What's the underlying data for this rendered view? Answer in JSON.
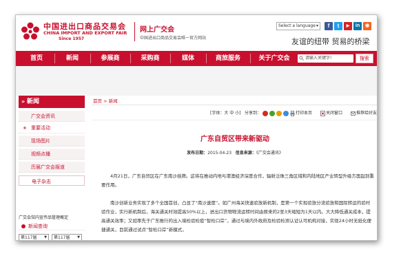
{
  "header": {
    "logo_cn": "中国进出口商品交易会",
    "logo_en": "CHINA IMPORT AND EXPORT FAIR",
    "logo_since": "Since 1957",
    "site_title": "网上广交会",
    "site_subtitle": "中国进出口商品交易会唯一官方网站",
    "language_select": "Select a language",
    "social_icons": [
      "facebook-icon",
      "twitter-icon",
      "youtube-icon",
      "linkedin-icon",
      "rss-icon"
    ],
    "slogan": "友谊的纽带   贸易的桥梁"
  },
  "nav": {
    "items": [
      "首页",
      "新闻",
      "参展商",
      "采购商",
      "媒体",
      "商旅服务",
      "关于广交会"
    ],
    "search_placeholder": "请输入关键字!",
    "search_button": "搜索"
  },
  "sidebar": {
    "heading": "新闻",
    "items": [
      "广交会资讯",
      "重要活动",
      "现场图片",
      "视频点播",
      "历届广交会报道",
      "电子杂志"
    ],
    "promo_text": "广交会馆内宣传品管理概定",
    "news_link": "新闻查询",
    "session_from": "第117届",
    "session_to": "第117届"
  },
  "main": {
    "breadcrumb": "首页 > 新闻",
    "font_size_label": "[字体：大 中 小]",
    "share_label": "分享到：",
    "print_label": "打印本页",
    "close_label": "关闭窗口",
    "recommend_label": "推荐给好友",
    "title": "广东自贸区带来新驱动",
    "meta_date_label": "发布日期：",
    "meta_date": "2015-04-23",
    "meta_source_label": "信息来源：",
    "meta_source": "《广交会通讯》",
    "paragraphs": [
      "4月21日，广东自贸区在广东南沙挂牌。这将在推动内地与港澳经济深度合作，辐射泛珠三角区域和内陆地区产业转型升级方面起到重要作用。",
      "南沙创新业务实现了多个全国首创，凸显了“南沙速度”。如广州海关快速验放新机制，是第一个实现验放分流验放和国际转运的验时验作业，实行新机制后，海关通关时效提高50%以上，进出口货物物流运转时间由原来的2至3天缩短为1天以内。大大降低通关成本，提高通关效率；又如率先于广东推行的出入境检验检疫“智检口岸”，通过与境内外政府及检验检测认证认可机构对接，实现24小时无纸化便捷通关，目前通过试点“智检口岸”新模式，"
    ]
  },
  "colors": {
    "brand_red": "#c8102e"
  }
}
